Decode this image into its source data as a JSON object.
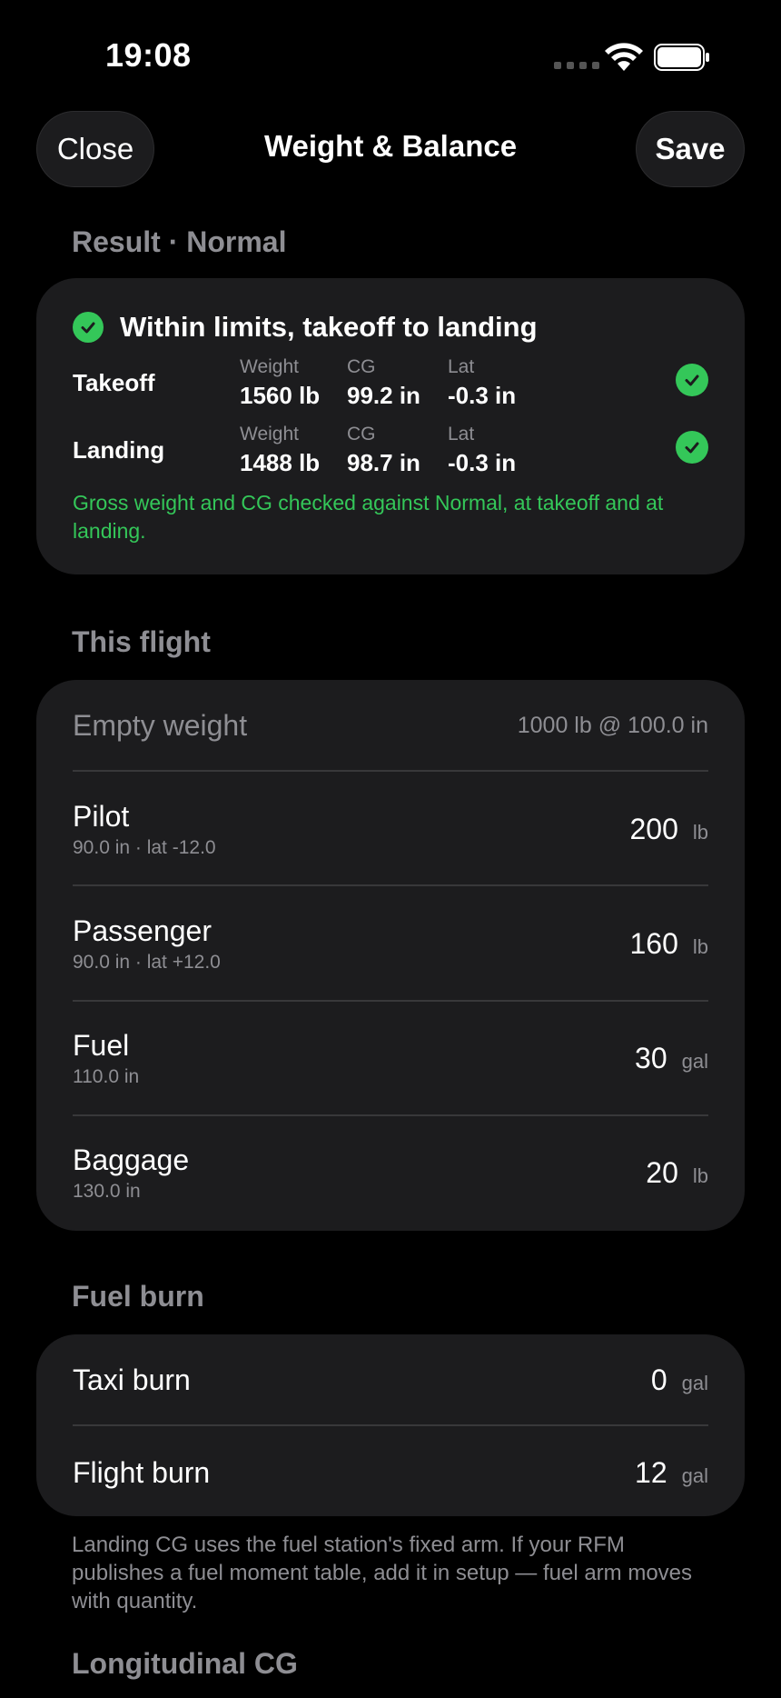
{
  "status": {
    "time": "19:08"
  },
  "nav": {
    "close_label": "Close",
    "title": "Weight & Balance",
    "save_label": "Save"
  },
  "result": {
    "section_label": "Result · Normal",
    "headline": "Within limits, takeoff to landing",
    "phases": [
      {
        "name": "Takeoff",
        "weight_label": "Weight",
        "weight": "1560 lb",
        "cg_label": "CG",
        "cg": "99.2 in",
        "lat_label": "Lat",
        "lat": "-0.3 in"
      },
      {
        "name": "Landing",
        "weight_label": "Weight",
        "weight": "1488 lb",
        "cg_label": "CG",
        "cg": "98.7 in",
        "lat_label": "Lat",
        "lat": "-0.3 in"
      }
    ],
    "note": "Gross weight and CG checked against Normal, at takeoff and at landing."
  },
  "flight": {
    "section_label": "This flight",
    "empty_weight": {
      "label": "Empty weight",
      "value": "1000 lb @ 100.0 in"
    },
    "items": [
      {
        "title": "Pilot",
        "sub": "90.0 in · lat -12.0",
        "value": "200",
        "unit": "lb"
      },
      {
        "title": "Passenger",
        "sub": "90.0 in · lat +12.0",
        "value": "160",
        "unit": "lb"
      },
      {
        "title": "Fuel",
        "sub": "110.0 in",
        "value": "30",
        "unit": "gal"
      },
      {
        "title": "Baggage",
        "sub": "130.0 in",
        "value": "20",
        "unit": "lb"
      }
    ]
  },
  "fuel_burn": {
    "section_label": "Fuel burn",
    "items": [
      {
        "title": "Taxi burn",
        "value": "0",
        "unit": "gal"
      },
      {
        "title": "Flight burn",
        "value": "12",
        "unit": "gal"
      }
    ],
    "footnote": "Landing CG uses the fuel station's fixed arm. If your RFM publishes a fuel moment table, add it in setup — fuel arm moves with quantity."
  },
  "longitudinal": {
    "section_label": "Longitudinal CG"
  },
  "colors": {
    "accent_green": "#34c759",
    "card_bg": "#1c1c1e",
    "secondary_text": "#8e8e93"
  }
}
